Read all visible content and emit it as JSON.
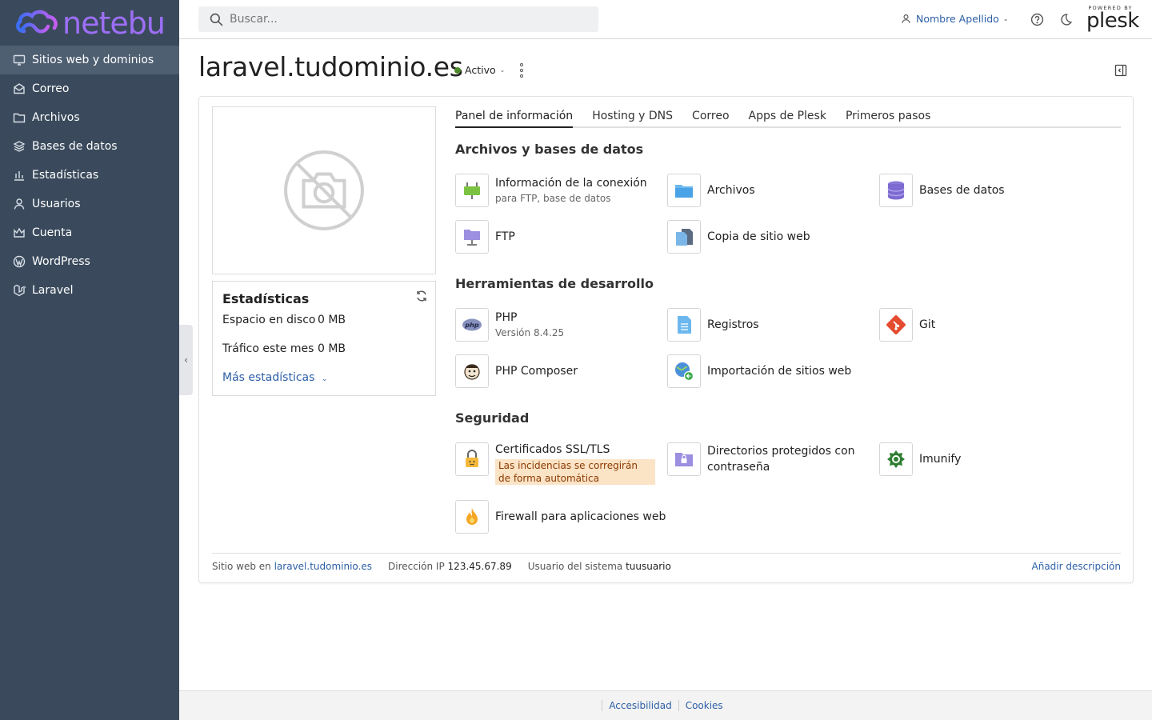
{
  "brand": {
    "logo_text": "netebu"
  },
  "sidebar": {
    "items": [
      {
        "label": "Sitios web y dominios",
        "icon": "monitor-icon",
        "active": true
      },
      {
        "label": "Correo",
        "icon": "mail-icon"
      },
      {
        "label": "Archivos",
        "icon": "folder-icon"
      },
      {
        "label": "Bases de datos",
        "icon": "layers-icon"
      },
      {
        "label": "Estadísticas",
        "icon": "bar-chart-icon"
      },
      {
        "label": "Usuarios",
        "icon": "user-icon"
      },
      {
        "label": "Cuenta",
        "icon": "crown-icon"
      },
      {
        "label": "WordPress",
        "icon": "wordpress-icon"
      },
      {
        "label": "Laravel",
        "icon": "laravel-icon"
      }
    ]
  },
  "topbar": {
    "search_placeholder": "Buscar...",
    "user_name": "Nombre Apellido",
    "plesk_powered": "POWERED BY",
    "plesk_name": "plesk"
  },
  "header": {
    "domain": "laravel.tudominio.es",
    "status": "Activo",
    "status_color": "#4f8a2a"
  },
  "stats": {
    "title": "Estadísticas",
    "disk_label": "Espacio en disco",
    "disk_value": "0 MB",
    "traffic_label": "Tráfico este mes",
    "traffic_value": "0 MB",
    "more": "Más estadísticas"
  },
  "tabs": [
    {
      "label": "Panel de información",
      "active": true
    },
    {
      "label": "Hosting y DNS"
    },
    {
      "label": "Correo"
    },
    {
      "label": "Apps de Plesk"
    },
    {
      "label": "Primeros pasos"
    }
  ],
  "sections": {
    "files_db": {
      "title": "Archivos y bases de datos",
      "connection": {
        "name": "Información de la conexión",
        "sub": "para FTP, base de datos"
      },
      "files": {
        "name": "Archivos"
      },
      "databases": {
        "name": "Bases de datos"
      },
      "ftp": {
        "name": "FTP"
      },
      "backup": {
        "name": "Copia de sitio web"
      }
    },
    "dev": {
      "title": "Herramientas de desarrollo",
      "php": {
        "name": "PHP",
        "sub": "Versión 8.4.25"
      },
      "logs": {
        "name": "Registros"
      },
      "git": {
        "name": "Git"
      },
      "composer": {
        "name": "PHP Composer"
      },
      "import": {
        "name": "Importación de sitios web"
      }
    },
    "security": {
      "title": "Seguridad",
      "ssl": {
        "name": "Certificados SSL/TLS",
        "warning": "Las incidencias se corregirán de forma automática"
      },
      "protected_dirs": {
        "name": "Directorios protegidos con contraseña"
      },
      "imunify": {
        "name": "Imunify"
      },
      "firewall": {
        "name": "Firewall para aplicaciones web"
      }
    }
  },
  "card_footer": {
    "site_label": "Sitio web en",
    "site_link": "laravel.tudominio.es",
    "ip_label": "Dirección IP",
    "ip_value": "123.45.67.89",
    "user_label": "Usuario del sistema",
    "user_value": "tuusuario",
    "add_description": "Añadir descripción"
  },
  "footer": {
    "accessibility": "Accesibilidad",
    "cookies": "Cookies"
  }
}
